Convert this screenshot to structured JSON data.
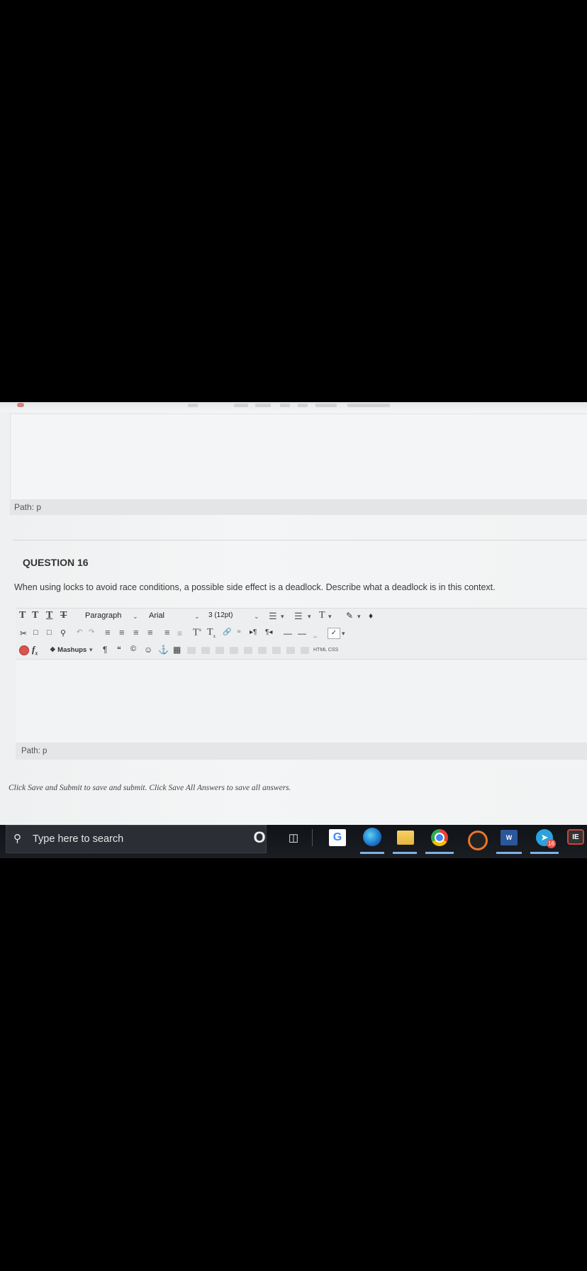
{
  "prev_editor": {
    "path": "Path: p"
  },
  "question": {
    "title": "QUESTION 16",
    "text": "When using locks to avoid race conditions, a possible side effect is a deadlock.  Describe what a deadlock is in this context."
  },
  "toolbar": {
    "row1": {
      "t_buttons": [
        "T",
        "T",
        "T",
        "T"
      ],
      "format_select": "Paragraph",
      "font_select": "Arial",
      "size_select": "3 (12pt)"
    },
    "row2": {
      "superscript": "T",
      "subscript": "T"
    },
    "row3": {
      "fx": "f",
      "mashups": "Mashups",
      "pilcrow": "¶",
      "quote": "“",
      "html_css": "HTML CSS"
    }
  },
  "editor": {
    "path": "Path: p"
  },
  "save_note": "Click Save and Submit to save and submit. Click Save All Answers to save all answers.",
  "taskbar": {
    "search_placeholder": "Type here to search",
    "badge_count": "16"
  },
  "icons": {
    "search": "search-icon",
    "cortana": "cortana-icon",
    "taskview": "task-view-icon",
    "google": "google-icon",
    "edge": "edge-icon",
    "explorer": "file-explorer-icon",
    "chrome": "chrome-icon",
    "word": "word-icon",
    "telegram": "telegram-icon"
  }
}
